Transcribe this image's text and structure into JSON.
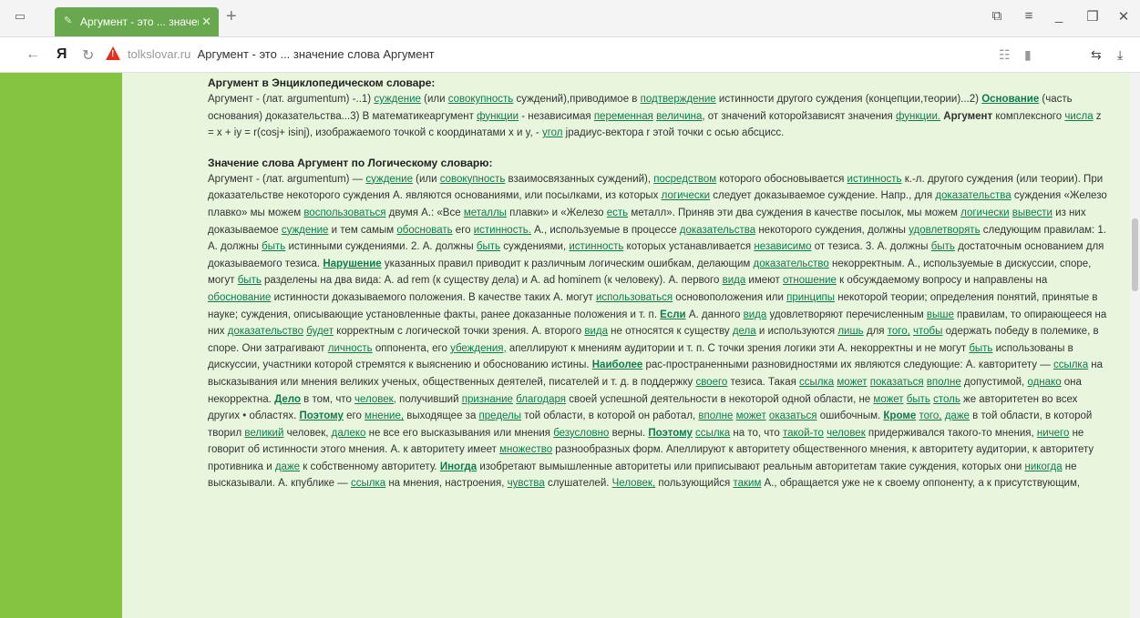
{
  "browser": {
    "tab_title": "Аргумент - это ... значен",
    "address_domain": "tolkslovar.ru",
    "address_title": "Аргумент - это ... значение слова Аргумент",
    "icons": [
      "tabs-icon",
      "close-icon",
      "new-tab-icon",
      "bookmark-icon",
      "menu-icon",
      "minimize-icon",
      "restore-icon",
      "close-window-icon",
      "back-icon",
      "yandex-logo-icon",
      "reload-icon",
      "warning-icon",
      "reader-icon",
      "bookmark-page-icon",
      "translate-icon",
      "download-icon"
    ]
  },
  "colors": {
    "accent": "#6aa84f",
    "sidebar": "#85c440",
    "content_bg": "#e9f6de",
    "link": "#0f7a4c"
  },
  "article": {
    "sections": [
      {
        "heading": "Аргумент в Энциклопедическом словаре:",
        "segments": [
          {
            "t": "Аргумент - (лат. argumentum) -..1) "
          },
          {
            "t": "суждение",
            "l": 1
          },
          {
            "t": " (или "
          },
          {
            "t": "совокупность",
            "l": 1
          },
          {
            "t": " суждений),приводимое в "
          },
          {
            "t": "подтверждение",
            "l": 1
          },
          {
            "t": " истинности другого суждения (концепции,теории)...2) "
          },
          {
            "t": "Основание",
            "l": 2
          },
          {
            "t": " (часть основания) доказательства...3) В математикеаргумент "
          },
          {
            "t": "функции",
            "l": 1
          },
          {
            "t": " - независимая "
          },
          {
            "t": "переменная",
            "l": 1
          },
          {
            "t": " "
          },
          {
            "t": "величина",
            "l": 1
          },
          {
            "t": ", от значений которойзависят значения "
          },
          {
            "t": "функции.",
            "l": 1
          },
          {
            "t": " "
          },
          {
            "t": "Аргумент",
            "b": 1
          },
          {
            "t": " комплексного "
          },
          {
            "t": "числа",
            "l": 1
          },
          {
            "t": " z = x + iy = r(cosj+ isinj), изображаемого точкой с координатами x и y, - "
          },
          {
            "t": "угол",
            "l": 1
          },
          {
            "t": " jрадиус-вектора r этой точки с осью абсцисс."
          }
        ]
      },
      {
        "heading": "Значение слова Аргумент по Логическому словарю:",
        "segments": [
          {
            "t": "Аргумент - (лат. argumentum)  — "
          },
          {
            "t": "суждение",
            "l": 1
          },
          {
            "t": " (или "
          },
          {
            "t": "совокупность",
            "l": 1
          },
          {
            "t": " взаимосвязанных суждений), "
          },
          {
            "t": "посредством",
            "l": 1
          },
          {
            "t": " которого обосновывается "
          },
          {
            "t": "истинность",
            "l": 1
          },
          {
            "t": " к.-л. другого суждения (или теории). При доказательстве некоторого суждения А. являются основаниями, или посылками, из которых "
          },
          {
            "t": "логически",
            "l": 1
          },
          {
            "t": " следует доказываемое суждение. Напр., для "
          },
          {
            "t": "доказательства",
            "l": 1
          },
          {
            "t": " суждения «Железо плавко» мы можем "
          },
          {
            "t": "воспользоваться",
            "l": 1
          },
          {
            "t": " двумя А.: «Все "
          },
          {
            "t": "металлы",
            "l": 1
          },
          {
            "t": " плавки» и «Железо "
          },
          {
            "t": "есть",
            "l": 1
          },
          {
            "t": " металл». Приняв эти два суждения в качестве посылок, мы можем "
          },
          {
            "t": "логически",
            "l": 1
          },
          {
            "t": " "
          },
          {
            "t": "вывести",
            "l": 1
          },
          {
            "t": " из них доказываемое "
          },
          {
            "t": "суждение",
            "l": 1
          },
          {
            "t": " и тем самым "
          },
          {
            "t": "обосновать",
            "l": 1
          },
          {
            "t": " его "
          },
          {
            "t": "истинность.",
            "l": 1
          },
          {
            "t": " А., используемые в процессе "
          },
          {
            "t": "доказательства",
            "l": 1
          },
          {
            "t": " некоторого суждения, должны "
          },
          {
            "t": "удовлетворять",
            "l": 1
          },
          {
            "t": " следующим правилам: 1. А. должны "
          },
          {
            "t": "быть",
            "l": 1
          },
          {
            "t": " истинными суждениями. 2. А. должны "
          },
          {
            "t": "быть",
            "l": 1
          },
          {
            "t": " суждениями, "
          },
          {
            "t": "истинность",
            "l": 1
          },
          {
            "t": " которых устанавливается "
          },
          {
            "t": "независимо",
            "l": 1
          },
          {
            "t": " от тезиса. 3. А. должны "
          },
          {
            "t": "быть",
            "l": 1
          },
          {
            "t": " достаточным основанием для доказываемого тезиса. "
          },
          {
            "t": "Нарушение",
            "l": 2
          },
          {
            "t": " указанных правил приводит к различным логическим ошибкам, делающим "
          },
          {
            "t": "доказательство",
            "l": 1
          },
          {
            "t": " некорректным. А., используемые в дискуссии, споре, могут "
          },
          {
            "t": "быть",
            "l": 1
          },
          {
            "t": " разделены на два вида: А. ad rem (к существу дела) и А. ad hominem (к человеку). А. первого "
          },
          {
            "t": "вида",
            "l": 1
          },
          {
            "t": " имеют "
          },
          {
            "t": "отношение",
            "l": 1
          },
          {
            "t": " к обсуждаемому вопросу и направлены на "
          },
          {
            "t": "обоснование",
            "l": 1
          },
          {
            "t": " истинности доказываемого положения. В качестве таких А. могут "
          },
          {
            "t": "использоваться",
            "l": 1
          },
          {
            "t": " основоположения или "
          },
          {
            "t": "принципы",
            "l": 1
          },
          {
            "t": " некоторой теории; определения понятий, принятые в науке; суждения, описывающие установленные факты, ранее доказанные положения и т. п. "
          },
          {
            "t": "Если",
            "l": 2
          },
          {
            "t": " А. данного "
          },
          {
            "t": "вида",
            "l": 1
          },
          {
            "t": " удовлетворяют перечисленным "
          },
          {
            "t": "выше",
            "l": 1
          },
          {
            "t": " правилам, то опирающееся на них "
          },
          {
            "t": "доказательство",
            "l": 1
          },
          {
            "t": " "
          },
          {
            "t": "будет",
            "l": 1
          },
          {
            "t": " корректным с логической точки зрения. А. второго "
          },
          {
            "t": "вида",
            "l": 1
          },
          {
            "t": " не относятся к существу "
          },
          {
            "t": "дела",
            "l": 1
          },
          {
            "t": " и используются "
          },
          {
            "t": "лишь",
            "l": 1
          },
          {
            "t": " для "
          },
          {
            "t": "того,",
            "l": 1
          },
          {
            "t": " "
          },
          {
            "t": "чтобы",
            "l": 1
          },
          {
            "t": " одержать победу в полемике, в споре. Они затрагивают "
          },
          {
            "t": "личность",
            "l": 1
          },
          {
            "t": " оппонента, его "
          },
          {
            "t": "убеждения,",
            "l": 1
          },
          {
            "t": " апеллируют к мнениям аудитории и т. п. С точки зрения логики эти А. некорректны и не могут "
          },
          {
            "t": "быть",
            "l": 1
          },
          {
            "t": " использованы в дискуссии, участники которой стремятся к выяснению и обоснованию истины. "
          },
          {
            "t": "Наиболее",
            "l": 2
          },
          {
            "t": " рас-пространенными разновидностями их являются следующие: А. кавторитету — "
          },
          {
            "t": "ссылка",
            "l": 1
          },
          {
            "t": " на высказывания или мнения великих ученых, общественных деятелей, писателей и т. д. в поддержку "
          },
          {
            "t": "своего",
            "l": 1
          },
          {
            "t": " тезиса. Такая "
          },
          {
            "t": "ссылка",
            "l": 1
          },
          {
            "t": " "
          },
          {
            "t": "может",
            "l": 1
          },
          {
            "t": " "
          },
          {
            "t": "показаться",
            "l": 1
          },
          {
            "t": " "
          },
          {
            "t": "вполне",
            "l": 1
          },
          {
            "t": " допустимой, "
          },
          {
            "t": "однако",
            "l": 1
          },
          {
            "t": " она некорректна. "
          },
          {
            "t": "Дело",
            "l": 2
          },
          {
            "t": " в том, что "
          },
          {
            "t": "человек,",
            "l": 1
          },
          {
            "t": " получивший "
          },
          {
            "t": "признание",
            "l": 1
          },
          {
            "t": " "
          },
          {
            "t": "благодаря",
            "l": 1
          },
          {
            "t": " своей успешной деятельности в некоторой одной области, не "
          },
          {
            "t": "может",
            "l": 1
          },
          {
            "t": " "
          },
          {
            "t": "быть",
            "l": 1
          },
          {
            "t": " "
          },
          {
            "t": "столь",
            "l": 1
          },
          {
            "t": " же авторитетен во всех других • областях. "
          },
          {
            "t": "Поэтому",
            "l": 2
          },
          {
            "t": " его "
          },
          {
            "t": "мнение,",
            "l": 1
          },
          {
            "t": " выходящее за "
          },
          {
            "t": "пределы",
            "l": 1
          },
          {
            "t": " той области, в которой он работал, "
          },
          {
            "t": "вполне",
            "l": 1
          },
          {
            "t": " "
          },
          {
            "t": "может",
            "l": 1
          },
          {
            "t": " "
          },
          {
            "t": "оказаться",
            "l": 1
          },
          {
            "t": " ошибочным. "
          },
          {
            "t": "Кроме",
            "l": 2
          },
          {
            "t": " "
          },
          {
            "t": "того,",
            "l": 1
          },
          {
            "t": " "
          },
          {
            "t": "даже",
            "l": 1
          },
          {
            "t": " в той области, в которой творил "
          },
          {
            "t": "великий",
            "l": 1
          },
          {
            "t": " человек, "
          },
          {
            "t": "далеко",
            "l": 1
          },
          {
            "t": " не все его высказывания или мнения "
          },
          {
            "t": "безусловно",
            "l": 1
          },
          {
            "t": " верны. "
          },
          {
            "t": "Поэтому",
            "l": 2
          },
          {
            "t": " "
          },
          {
            "t": "ссылка",
            "l": 1
          },
          {
            "t": " на то, что "
          },
          {
            "t": "такой-то",
            "l": 1
          },
          {
            "t": " "
          },
          {
            "t": "человек",
            "l": 1
          },
          {
            "t": " придерживался такого-то мнения, "
          },
          {
            "t": "ничего",
            "l": 1
          },
          {
            "t": " не говорит об истинности этого мнения. А. к авторитету имеет "
          },
          {
            "t": "множество",
            "l": 1
          },
          {
            "t": " разнообразных форм. Апеллируют к авторитету общественного мнения, к авторитету аудитории, к авторитету противника и "
          },
          {
            "t": "даже",
            "l": 1
          },
          {
            "t": " к собственному авторитету. "
          },
          {
            "t": "Иногда",
            "l": 2
          },
          {
            "t": " изобретают вымышленные авторитеты или приписывают реальным авторитетам такие суждения, которых они "
          },
          {
            "t": "никогда",
            "l": 1
          },
          {
            "t": " не высказывали. А. кпублике — "
          },
          {
            "t": "ссылка",
            "l": 1
          },
          {
            "t": " на мнения, настроения, "
          },
          {
            "t": "чувства",
            "l": 1
          },
          {
            "t": " слушателей. "
          },
          {
            "t": "Человек,",
            "l": 1
          },
          {
            "t": " пользующийся "
          },
          {
            "t": "таким",
            "l": 1
          },
          {
            "t": " А., обращается уже не к своему оппоненту, а к присутствующим,"
          }
        ]
      }
    ]
  }
}
